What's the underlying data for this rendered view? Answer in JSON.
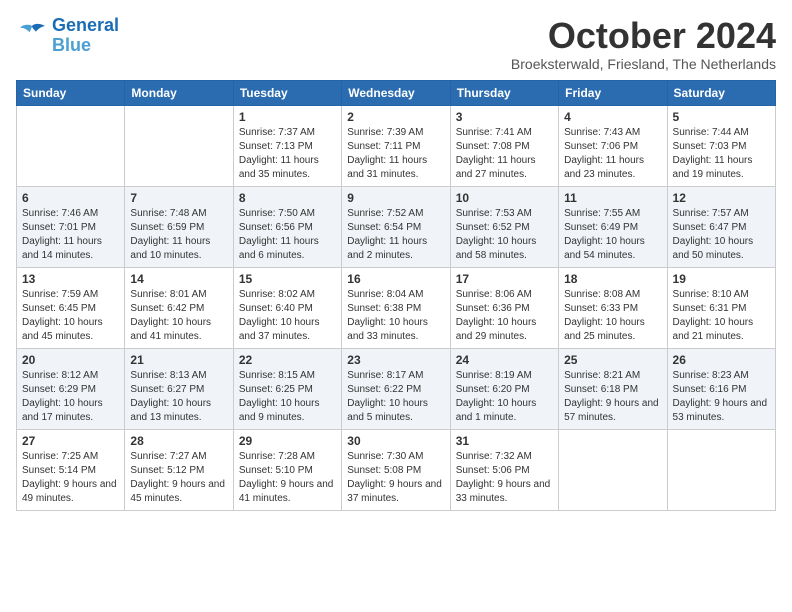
{
  "header": {
    "logo_line1": "General",
    "logo_line2": "Blue",
    "month": "October 2024",
    "location": "Broeksterwald, Friesland, The Netherlands"
  },
  "weekdays": [
    "Sunday",
    "Monday",
    "Tuesday",
    "Wednesday",
    "Thursday",
    "Friday",
    "Saturday"
  ],
  "weeks": [
    [
      {
        "day": null,
        "info": null
      },
      {
        "day": null,
        "info": null
      },
      {
        "day": "1",
        "sunrise": "7:37 AM",
        "sunset": "7:13 PM",
        "daylight": "11 hours and 35 minutes."
      },
      {
        "day": "2",
        "sunrise": "7:39 AM",
        "sunset": "7:11 PM",
        "daylight": "11 hours and 31 minutes."
      },
      {
        "day": "3",
        "sunrise": "7:41 AM",
        "sunset": "7:08 PM",
        "daylight": "11 hours and 27 minutes."
      },
      {
        "day": "4",
        "sunrise": "7:43 AM",
        "sunset": "7:06 PM",
        "daylight": "11 hours and 23 minutes."
      },
      {
        "day": "5",
        "sunrise": "7:44 AM",
        "sunset": "7:03 PM",
        "daylight": "11 hours and 19 minutes."
      }
    ],
    [
      {
        "day": "6",
        "sunrise": "7:46 AM",
        "sunset": "7:01 PM",
        "daylight": "11 hours and 14 minutes."
      },
      {
        "day": "7",
        "sunrise": "7:48 AM",
        "sunset": "6:59 PM",
        "daylight": "11 hours and 10 minutes."
      },
      {
        "day": "8",
        "sunrise": "7:50 AM",
        "sunset": "6:56 PM",
        "daylight": "11 hours and 6 minutes."
      },
      {
        "day": "9",
        "sunrise": "7:52 AM",
        "sunset": "6:54 PM",
        "daylight": "11 hours and 2 minutes."
      },
      {
        "day": "10",
        "sunrise": "7:53 AM",
        "sunset": "6:52 PM",
        "daylight": "10 hours and 58 minutes."
      },
      {
        "day": "11",
        "sunrise": "7:55 AM",
        "sunset": "6:49 PM",
        "daylight": "10 hours and 54 minutes."
      },
      {
        "day": "12",
        "sunrise": "7:57 AM",
        "sunset": "6:47 PM",
        "daylight": "10 hours and 50 minutes."
      }
    ],
    [
      {
        "day": "13",
        "sunrise": "7:59 AM",
        "sunset": "6:45 PM",
        "daylight": "10 hours and 45 minutes."
      },
      {
        "day": "14",
        "sunrise": "8:01 AM",
        "sunset": "6:42 PM",
        "daylight": "10 hours and 41 minutes."
      },
      {
        "day": "15",
        "sunrise": "8:02 AM",
        "sunset": "6:40 PM",
        "daylight": "10 hours and 37 minutes."
      },
      {
        "day": "16",
        "sunrise": "8:04 AM",
        "sunset": "6:38 PM",
        "daylight": "10 hours and 33 minutes."
      },
      {
        "day": "17",
        "sunrise": "8:06 AM",
        "sunset": "6:36 PM",
        "daylight": "10 hours and 29 minutes."
      },
      {
        "day": "18",
        "sunrise": "8:08 AM",
        "sunset": "6:33 PM",
        "daylight": "10 hours and 25 minutes."
      },
      {
        "day": "19",
        "sunrise": "8:10 AM",
        "sunset": "6:31 PM",
        "daylight": "10 hours and 21 minutes."
      }
    ],
    [
      {
        "day": "20",
        "sunrise": "8:12 AM",
        "sunset": "6:29 PM",
        "daylight": "10 hours and 17 minutes."
      },
      {
        "day": "21",
        "sunrise": "8:13 AM",
        "sunset": "6:27 PM",
        "daylight": "10 hours and 13 minutes."
      },
      {
        "day": "22",
        "sunrise": "8:15 AM",
        "sunset": "6:25 PM",
        "daylight": "10 hours and 9 minutes."
      },
      {
        "day": "23",
        "sunrise": "8:17 AM",
        "sunset": "6:22 PM",
        "daylight": "10 hours and 5 minutes."
      },
      {
        "day": "24",
        "sunrise": "8:19 AM",
        "sunset": "6:20 PM",
        "daylight": "10 hours and 1 minute."
      },
      {
        "day": "25",
        "sunrise": "8:21 AM",
        "sunset": "6:18 PM",
        "daylight": "9 hours and 57 minutes."
      },
      {
        "day": "26",
        "sunrise": "8:23 AM",
        "sunset": "6:16 PM",
        "daylight": "9 hours and 53 minutes."
      }
    ],
    [
      {
        "day": "27",
        "sunrise": "7:25 AM",
        "sunset": "5:14 PM",
        "daylight": "9 hours and 49 minutes."
      },
      {
        "day": "28",
        "sunrise": "7:27 AM",
        "sunset": "5:12 PM",
        "daylight": "9 hours and 45 minutes."
      },
      {
        "day": "29",
        "sunrise": "7:28 AM",
        "sunset": "5:10 PM",
        "daylight": "9 hours and 41 minutes."
      },
      {
        "day": "30",
        "sunrise": "7:30 AM",
        "sunset": "5:08 PM",
        "daylight": "9 hours and 37 minutes."
      },
      {
        "day": "31",
        "sunrise": "7:32 AM",
        "sunset": "5:06 PM",
        "daylight": "9 hours and 33 minutes."
      },
      {
        "day": null,
        "info": null
      },
      {
        "day": null,
        "info": null
      }
    ]
  ],
  "labels": {
    "sunrise": "Sunrise:",
    "sunset": "Sunset:",
    "daylight": "Daylight:"
  }
}
